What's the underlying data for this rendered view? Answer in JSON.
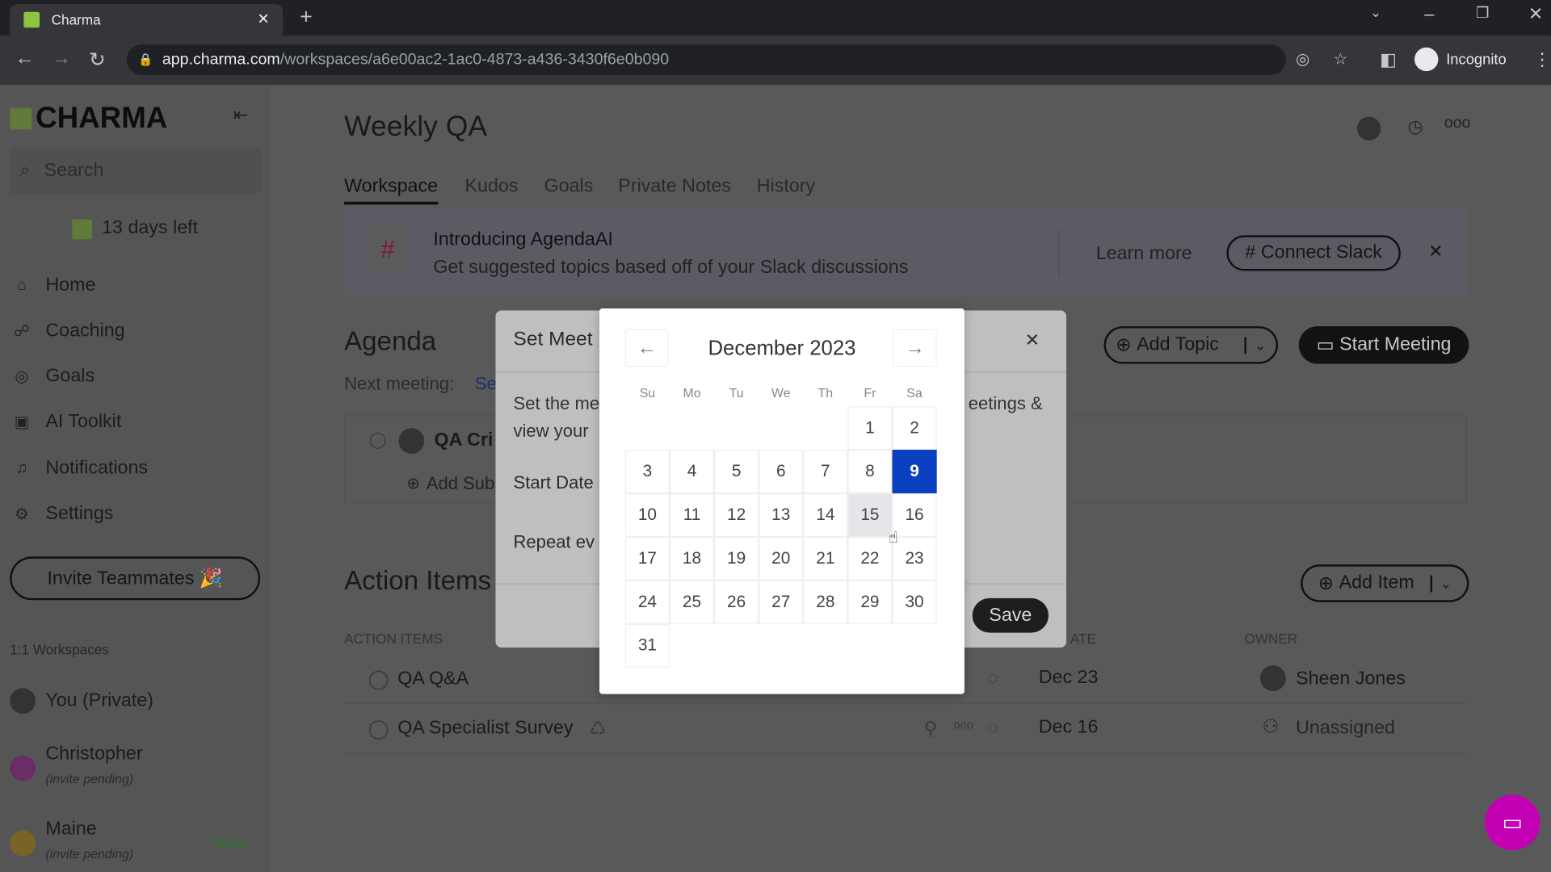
{
  "browser": {
    "tab_title": "Charma",
    "url_host": "app.charma.com",
    "url_path": "/workspaces/a6e00ac2-1ac0-4873-a436-3430f6e0b090",
    "profile": "Incognito"
  },
  "sidebar": {
    "logo": "CHARMA",
    "search_placeholder": "Search",
    "trial": "13 days left",
    "items": [
      {
        "label": "Home",
        "icon": "home-icon"
      },
      {
        "label": "Coaching",
        "icon": "coaching-icon"
      },
      {
        "label": "Goals",
        "icon": "goals-icon"
      },
      {
        "label": "AI Toolkit",
        "icon": "robot-icon"
      },
      {
        "label": "Notifications",
        "icon": "bell-icon"
      },
      {
        "label": "Settings",
        "icon": "gear-icon"
      }
    ],
    "invite": "Invite Teammates 🎉",
    "section": "1:1 Workspaces",
    "workspaces": [
      {
        "name": "You (Private)",
        "sub": ""
      },
      {
        "name": "Christopher",
        "sub": "(invite pending)"
      },
      {
        "name": "Maine",
        "sub": "(invite pending)",
        "badge": "New"
      }
    ]
  },
  "header": {
    "title": "Weekly QA",
    "tabs": [
      "Workspace",
      "Kudos",
      "Goals",
      "Private Notes",
      "History"
    ],
    "active_tab": "Workspace"
  },
  "banner": {
    "title": "Introducing AgendaAI",
    "text": "Get suggested topics based off of your Slack discussions",
    "learn_more": "Learn more",
    "connect": "Connect Slack"
  },
  "agenda": {
    "title": "Agenda",
    "next_meeting_label": "Next meeting:",
    "next_meeting_link": "Se",
    "topic": "QA Cri",
    "add_sub": "Add Sub",
    "add_topic": "Add Topic",
    "start_meeting": "Start Meeting"
  },
  "action_items": {
    "title": "Action Items",
    "add_item": "Add Item",
    "col_items": "ACTION ITEMS",
    "col_date": "ATE",
    "col_owner": "OWNER",
    "rows": [
      {
        "name": "QA Q&A",
        "date": "Dec 23",
        "owner": "Sheen Jones"
      },
      {
        "name": "QA Specialist Survey",
        "date": "Dec 16",
        "owner": "Unassigned"
      }
    ]
  },
  "modal": {
    "title": "Set Meet",
    "desc1": "Set the me",
    "desc1_end": "eetings &",
    "desc2": "view your",
    "start_date": "Start Date",
    "repeat": "Repeat ev",
    "save": "Save"
  },
  "calendar": {
    "month": "December 2023",
    "dow": [
      "Su",
      "Mo",
      "Tu",
      "We",
      "Th",
      "Fr",
      "Sa"
    ],
    "selected": 9,
    "hovered": 15,
    "weeks": [
      [
        null,
        null,
        null,
        null,
        null,
        1,
        2
      ],
      [
        3,
        4,
        5,
        6,
        7,
        8,
        9
      ],
      [
        10,
        11,
        12,
        13,
        14,
        15,
        16
      ],
      [
        17,
        18,
        19,
        20,
        21,
        22,
        23
      ],
      [
        24,
        25,
        26,
        27,
        28,
        29,
        30
      ],
      [
        31,
        null,
        null,
        null,
        null,
        null,
        null
      ]
    ]
  },
  "colors": {
    "brand": "#8cc63f",
    "selected": "#0a3fbf",
    "chat": "#c400b4"
  }
}
